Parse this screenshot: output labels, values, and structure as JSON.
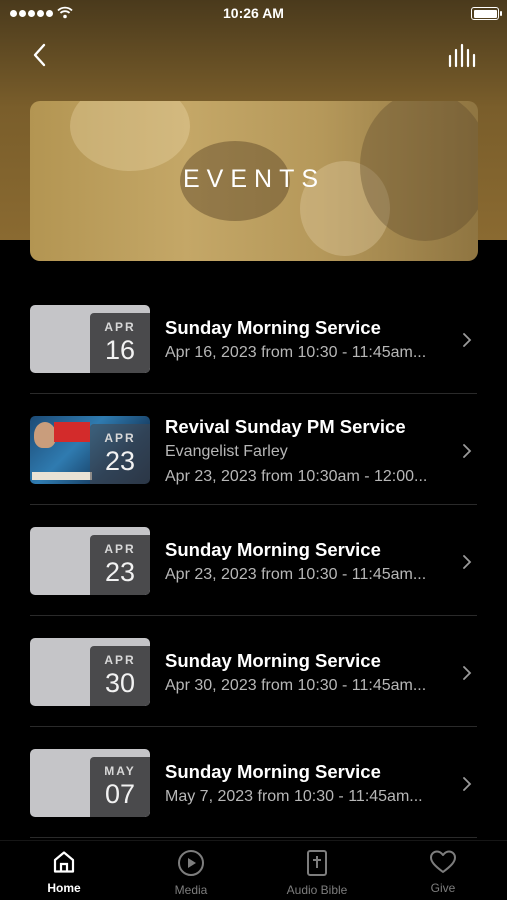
{
  "status_bar": {
    "time": "10:26 AM",
    "icons": [
      "signal-dots-icon",
      "wifi-icon",
      "battery-icon"
    ]
  },
  "nav": {
    "back_icon": "chevron-left-icon",
    "right_icon": "audio-bars-icon"
  },
  "banner": {
    "title": "EVENTS"
  },
  "events": [
    {
      "title": "Sunday Morning Service",
      "subtitle": "",
      "date_text": "Apr 16, 2023 from 10:30 - 11:45am...",
      "month": "APR",
      "day": "16",
      "thumb": "plain"
    },
    {
      "title": "Revival Sunday PM Service",
      "subtitle": "Evangelist Farley",
      "date_text": "Apr 23, 2023 from 10:30am - 12:00...",
      "month": "APR",
      "day": "23",
      "thumb": "photo"
    },
    {
      "title": "Sunday Morning Service",
      "subtitle": "",
      "date_text": "Apr 23, 2023 from 10:30 - 11:45am...",
      "month": "APR",
      "day": "23",
      "thumb": "plain"
    },
    {
      "title": "Sunday Morning Service",
      "subtitle": "",
      "date_text": "Apr 30, 2023 from 10:30 - 11:45am...",
      "month": "APR",
      "day": "30",
      "thumb": "plain"
    },
    {
      "title": "Sunday Morning Service",
      "subtitle": "",
      "date_text": "May 7, 2023 from 10:30 - 11:45am...",
      "month": "MAY",
      "day": "07",
      "thumb": "plain"
    }
  ],
  "tabs": [
    {
      "label": "Home",
      "icon": "home-icon",
      "active": true
    },
    {
      "label": "Media",
      "icon": "play-circle-icon",
      "active": false
    },
    {
      "label": "Audio Bible",
      "icon": "bible-icon",
      "active": false
    },
    {
      "label": "Give",
      "icon": "heart-icon",
      "active": false
    }
  ],
  "colors": {
    "header_brown": "#7a5e2b",
    "banner_gold": "#c4a767",
    "background": "#000000",
    "date_box": "#4a4a4c"
  }
}
